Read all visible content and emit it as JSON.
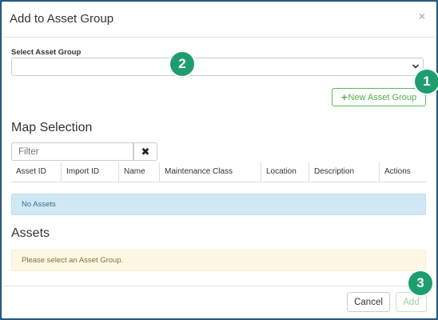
{
  "dialog": {
    "title": "Add to Asset Group",
    "close_glyph": "×"
  },
  "asset_group": {
    "label": "Select Asset Group",
    "selected_value": "",
    "new_button_label": "New Asset Group",
    "new_button_icon": "plus-icon"
  },
  "map_selection": {
    "heading": "Map Selection",
    "filter_placeholder": "Filter",
    "clear_glyph": "✖",
    "columns": [
      "Asset ID",
      "Import ID",
      "Name",
      "Maintenance Class",
      "Location",
      "Description",
      "Actions"
    ],
    "empty_message": "No Assets"
  },
  "assets": {
    "heading": "Assets",
    "warning_message": "Please select an Asset Group."
  },
  "footer": {
    "cancel_label": "Cancel",
    "add_label": "Add"
  },
  "callouts": [
    "1",
    "2",
    "3"
  ],
  "colors": {
    "accent_green": "#5cb85c",
    "callout_green": "#1e9e6e",
    "info_bg": "#d1e7f3",
    "warning_bg": "#fcf8e3"
  }
}
